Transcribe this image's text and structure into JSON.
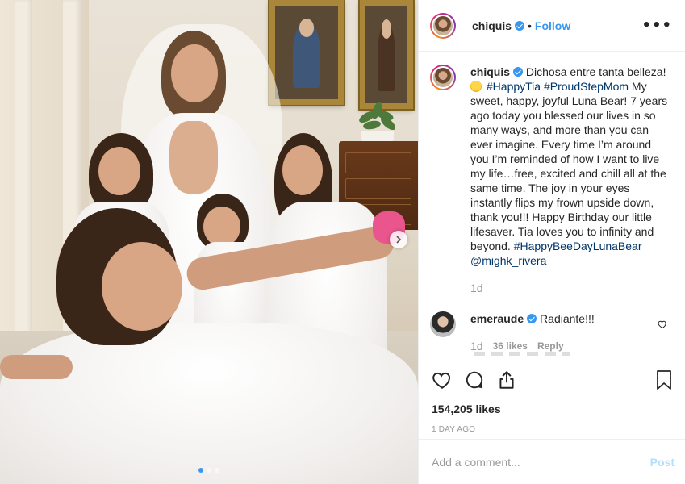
{
  "header": {
    "username": "chiquis",
    "separator": "•",
    "follow_label": "Follow",
    "more_label": "•••"
  },
  "caption": {
    "username": "chiquis",
    "text_1": "Dichosa entre tanta belleza!",
    "emoji": "smiling-face-emoji",
    "hashtag_1": "#HappyTia",
    "hashtag_2": "#ProudStepMom",
    "text_2": "My sweet, happy, joyful Luna Bear! 7 years ago today you blessed our lives in so many ways, and more than you can ever imagine. Every time I’m around you I’m reminded of how I want to live my life…free, excited and chill all at the same time. The joy in your eyes instantly flips my frown upside down, thank you!!! Happy Birthday our little lifesaver. Tia loves you to infinity and beyond.",
    "hashtag_3": "#HappyBeeDayLunaBear",
    "mention": "@mighk_rivera",
    "age": "1d"
  },
  "comments": [
    {
      "username": "emeraude",
      "text": "Radiante!!!",
      "age": "1d",
      "likes": "36 likes",
      "reply_label": "Reply"
    }
  ],
  "actions": {
    "likes_count": "154,205 likes",
    "timestamp": "1 DAY AGO"
  },
  "add_comment": {
    "placeholder": "Add a comment...",
    "post_label": "Post"
  },
  "carousel": {
    "slide_count": 3,
    "active_index": 0
  },
  "colors": {
    "accent": "#3897f0",
    "hashtag": "#003569",
    "muted": "#999999",
    "text": "#262626"
  }
}
